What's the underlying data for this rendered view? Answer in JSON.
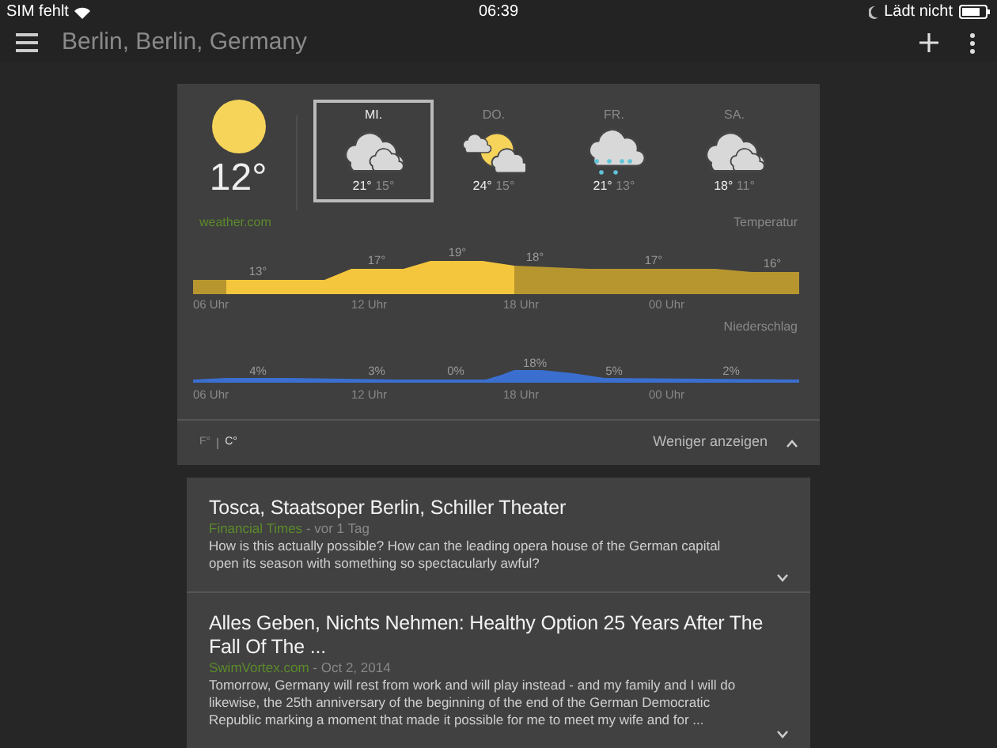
{
  "status_bar": {
    "carrier": "SIM fehlt",
    "time": "06:39",
    "charging": "Lädt nicht"
  },
  "app_bar": {
    "title": "Berlin, Berlin, Germany"
  },
  "weather": {
    "current_temp": "12°",
    "source": "weather.com",
    "days": [
      {
        "label": "MI.",
        "kind": "cloudy",
        "high": "21°",
        "low": "15°",
        "selected": true
      },
      {
        "label": "DO.",
        "kind": "partly_sunny",
        "high": "24°",
        "low": "15°",
        "selected": false
      },
      {
        "label": "FR.",
        "kind": "rain",
        "high": "21°",
        "low": "13°",
        "selected": false
      },
      {
        "label": "SA.",
        "kind": "cloudy",
        "high": "18°",
        "low": "11°",
        "selected": false
      }
    ],
    "temperature": {
      "title": "Temperatur",
      "values": [
        "13°",
        "17°",
        "19°",
        "18°",
        "17°",
        "16°"
      ],
      "times": [
        "06 Uhr",
        "12 Uhr",
        "18 Uhr",
        "00 Uhr"
      ]
    },
    "precipitation": {
      "title": "Niederschlag",
      "values": [
        "4%",
        "3%",
        "0%",
        "18%",
        "5%",
        "2%"
      ],
      "times": [
        "06 Uhr",
        "12 Uhr",
        "18 Uhr",
        "00 Uhr"
      ]
    },
    "units": [
      {
        "label": "F°",
        "selected": false
      },
      {
        "label": "C°",
        "selected": true
      }
    ],
    "toggle": "Weniger anzeigen"
  },
  "news": [
    {
      "title": "Tosca, Staatsoper Berlin, Schiller Theater",
      "source": "Financial Times",
      "time": "- vor 1 Tag",
      "snippet": "How is this actually possible? How can the leading opera house of the German capital open its season with something so spectacularly awful?"
    },
    {
      "title": "Alles Geben, Nichts Nehmen: Healthy Option 25 Years After The Fall Of The ...",
      "source": "SwimVortex.com",
      "time": "- Oct 2, 2014",
      "snippet": "Tomorrow, Germany will rest from work and will play instead - and my family and I will do likewise, the 25th anniversary of the beginning of the end of the German Democratic Republic marking a moment that made it possible for me to meet my wife and for ..."
    }
  ]
}
